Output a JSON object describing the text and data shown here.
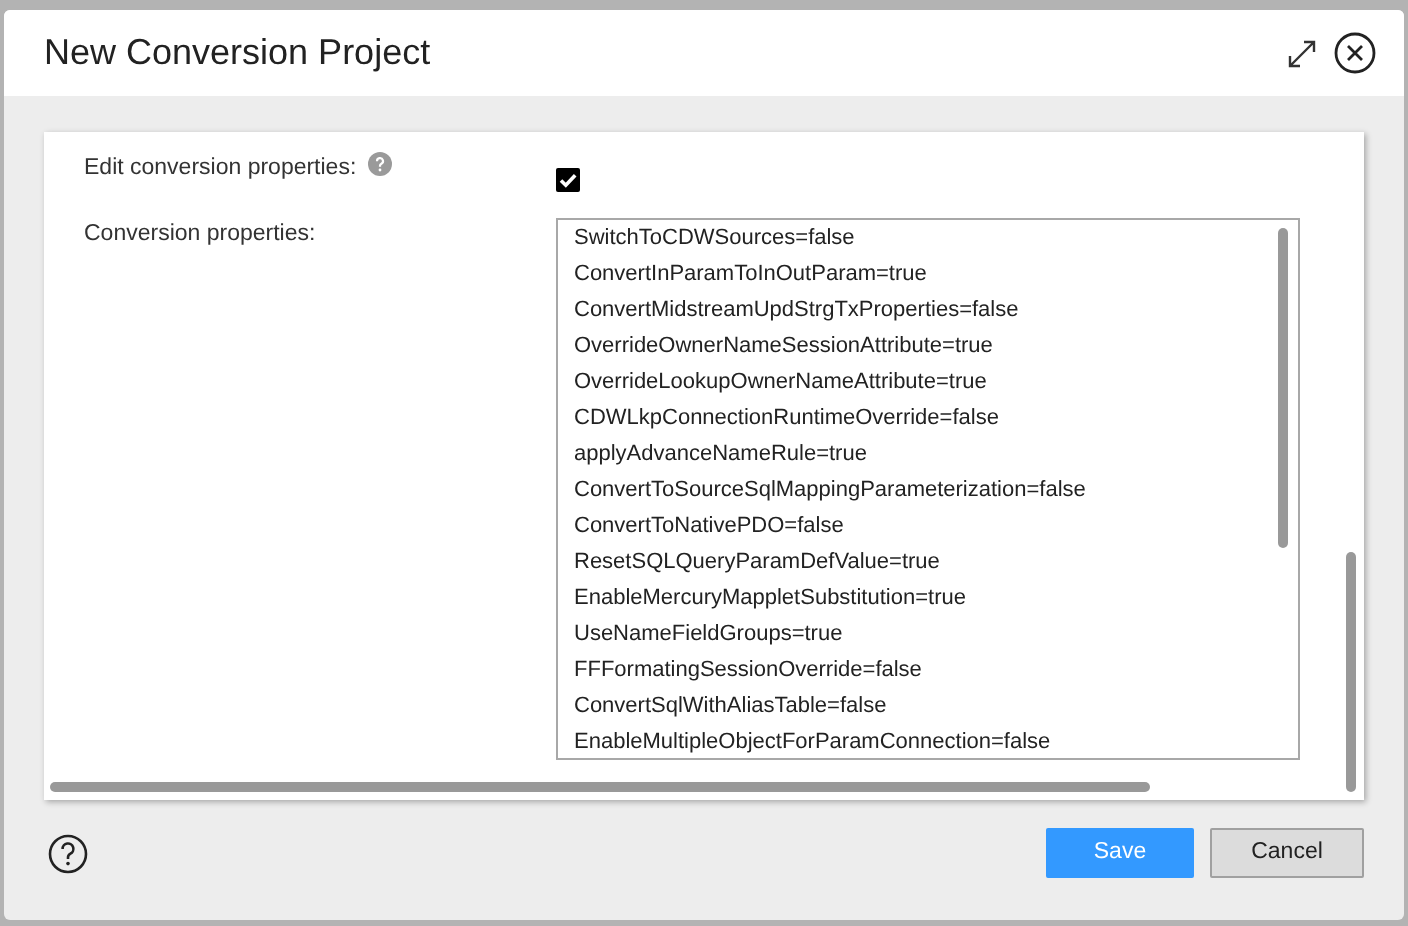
{
  "dialog": {
    "title": "New Conversion Project"
  },
  "fields": [
    {
      "kind": "checkbox",
      "label": "Edit conversion properties:",
      "help": true,
      "checked": true
    },
    {
      "kind": "textarea",
      "label": "Conversion properties:",
      "help": false,
      "lines": [
        "SwitchToCDWSources=false",
        "ConvertInParamToInOutParam=true",
        "ConvertMidstreamUpdStrgTxProperties=false",
        "OverrideOwnerNameSessionAttribute=true",
        "OverrideLookupOwnerNameAttribute=true",
        "CDWLkpConnectionRuntimeOverride=false",
        "applyAdvanceNameRule=true",
        "ConvertToSourceSqlMappingParameterization=false",
        "ConvertToNativePDO=false",
        "ResetSQLQueryParamDefValue=true",
        "EnableMercuryMappletSubstitution=true",
        "UseNameFieldGroups=true",
        "FFFormatingSessionOverride=false",
        "ConvertSqlWithAliasTable=false",
        "EnableMultipleObjectForParamConnection=false"
      ]
    }
  ],
  "buttons": [
    {
      "label": "Save",
      "kind": "primary"
    },
    {
      "label": "Cancel",
      "kind": "secondary"
    }
  ]
}
